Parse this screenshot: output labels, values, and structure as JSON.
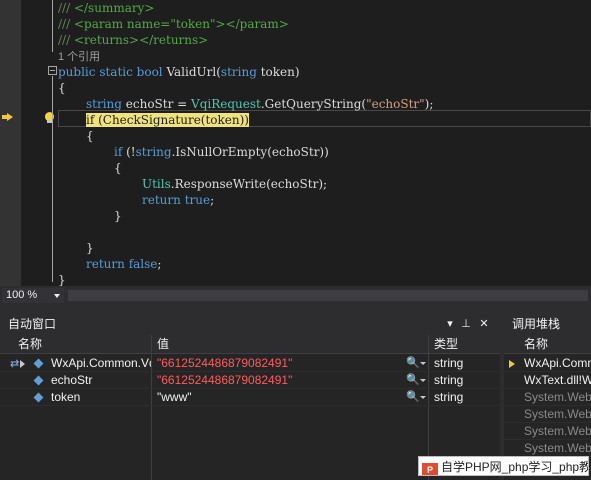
{
  "editor": {
    "lines": [
      {
        "indent": 1,
        "tokens": [
          {
            "t": "/// ",
            "c": "c-doc"
          },
          {
            "t": "</summary>",
            "c": "c-comment"
          }
        ]
      },
      {
        "indent": 1,
        "tokens": [
          {
            "t": "/// ",
            "c": "c-doc"
          },
          {
            "t": "<param name=\"token\"></param>",
            "c": "c-comment"
          }
        ]
      },
      {
        "indent": 1,
        "tokens": [
          {
            "t": "/// ",
            "c": "c-doc"
          },
          {
            "t": "<returns></returns>",
            "c": "c-comment"
          }
        ]
      },
      {
        "indent": 1,
        "tokens": [
          {
            "t": "1 个引用",
            "c": "c-ref"
          }
        ]
      },
      {
        "indent": 1,
        "tokens": [
          {
            "t": "public",
            "c": "c-kw"
          },
          {
            "t": " "
          },
          {
            "t": "static",
            "c": "c-kw"
          },
          {
            "t": " "
          },
          {
            "t": "bool",
            "c": "c-kw"
          },
          {
            "t": " ValidUrl("
          },
          {
            "t": "string",
            "c": "c-kw"
          },
          {
            "t": " token)"
          }
        ]
      },
      {
        "indent": 1,
        "tokens": [
          {
            "t": "{"
          }
        ]
      },
      {
        "indent": 2,
        "tokens": [
          {
            "t": "string",
            "c": "c-kw"
          },
          {
            "t": " echoStr = "
          },
          {
            "t": "VqiRequest",
            "c": "c-type"
          },
          {
            "t": ".GetQueryString("
          },
          {
            "t": "\"echoStr\"",
            "c": "c-str"
          },
          {
            "t": ");"
          }
        ]
      },
      {
        "indent": 2,
        "tokens": [
          {
            "t": "if (CheckSignature(token))",
            "c": "c-hl"
          }
        ]
      },
      {
        "indent": 2,
        "tokens": [
          {
            "t": "{"
          }
        ]
      },
      {
        "indent": 3,
        "tokens": [
          {
            "t": "if",
            "c": "c-kw"
          },
          {
            "t": " (!"
          },
          {
            "t": "string",
            "c": "c-kw"
          },
          {
            "t": ".IsNullOrEmpty(echoStr))"
          }
        ]
      },
      {
        "indent": 3,
        "tokens": [
          {
            "t": "{"
          }
        ]
      },
      {
        "indent": 4,
        "tokens": [
          {
            "t": "Utils",
            "c": "c-type"
          },
          {
            "t": ".ResponseWrite(echoStr);"
          }
        ]
      },
      {
        "indent": 4,
        "tokens": [
          {
            "t": "return",
            "c": "c-kw"
          },
          {
            "t": " "
          },
          {
            "t": "true",
            "c": "c-kw"
          },
          {
            "t": ";"
          }
        ]
      },
      {
        "indent": 3,
        "tokens": [
          {
            "t": "}"
          }
        ]
      },
      {
        "indent": 2,
        "tokens": []
      },
      {
        "indent": 2,
        "tokens": [
          {
            "t": "}"
          }
        ]
      },
      {
        "indent": 2,
        "tokens": [
          {
            "t": "return",
            "c": "c-kw"
          },
          {
            "t": " "
          },
          {
            "t": "false",
            "c": "c-kw"
          },
          {
            "t": ";"
          }
        ]
      },
      {
        "indent": 1,
        "tokens": [
          {
            "t": "}"
          }
        ]
      }
    ],
    "zoom": "100 %",
    "icons": {
      "execution_pointer": "execution-arrow-icon",
      "quick_action": "lightbulb-icon"
    }
  },
  "autos": {
    "title": "自动窗口",
    "columns": {
      "name": "名称",
      "value": "值",
      "type": "类型"
    },
    "title_buttons": [
      "▾",
      "⊥",
      "✕"
    ],
    "rows": [
      {
        "name": "WxApi.Common.Vq",
        "value": "\"6612524486879082491\"",
        "type": "string",
        "changed": true,
        "expandable": true,
        "returned": true
      },
      {
        "name": "echoStr",
        "value": "\"6612524486879082491\"",
        "type": "string",
        "changed": true,
        "expandable": false,
        "returned": false
      },
      {
        "name": "token",
        "value": "\"www\"",
        "type": "string",
        "changed": false,
        "expandable": false,
        "returned": false
      }
    ]
  },
  "callstack": {
    "title": "调用堆栈",
    "column": "名称",
    "rows": [
      {
        "text": "WxApi.Comm",
        "current": true,
        "external": false
      },
      {
        "text": "WxText.dll!W",
        "current": false,
        "external": false
      },
      {
        "text": "System.Web",
        "current": false,
        "external": true
      },
      {
        "text": "System.Web",
        "current": false,
        "external": true
      },
      {
        "text": "System.Web",
        "current": false,
        "external": true
      },
      {
        "text": "System.Web",
        "current": false,
        "external": true
      }
    ]
  },
  "watermark": {
    "text": "自学PHP网_php学习_php教"
  }
}
